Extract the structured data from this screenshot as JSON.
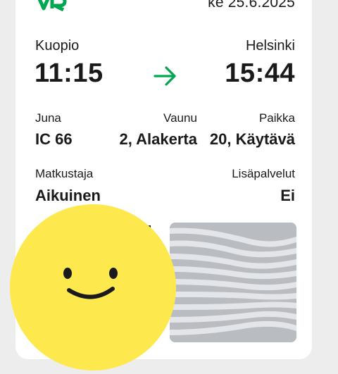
{
  "ticket": {
    "date": "ke 25.6.2025",
    "departure": {
      "station": "Kuopio",
      "time": "11:15"
    },
    "arrival": {
      "station": "Helsinki",
      "time": "15:44"
    },
    "train": {
      "label": "Juna",
      "value": "IC 66"
    },
    "car": {
      "label": "Vaunu",
      "value": "2, Alakerta"
    },
    "seat": {
      "label": "Paikka",
      "value": "20, Käytävä"
    },
    "passenger": {
      "label": "Matkustaja",
      "value": "Aikuinen"
    },
    "extras": {
      "label": "Lisäpalvelut",
      "value": "Ei"
    }
  },
  "icons": {
    "logo": "vr-logo-icon",
    "arrow": "arrow-right-icon",
    "overlay": "smiley-face-icon"
  },
  "colors": {
    "brand_green": "#00a651",
    "smiley_yellow": "#fde94d",
    "pattern_gray": "#b9bcc1"
  }
}
